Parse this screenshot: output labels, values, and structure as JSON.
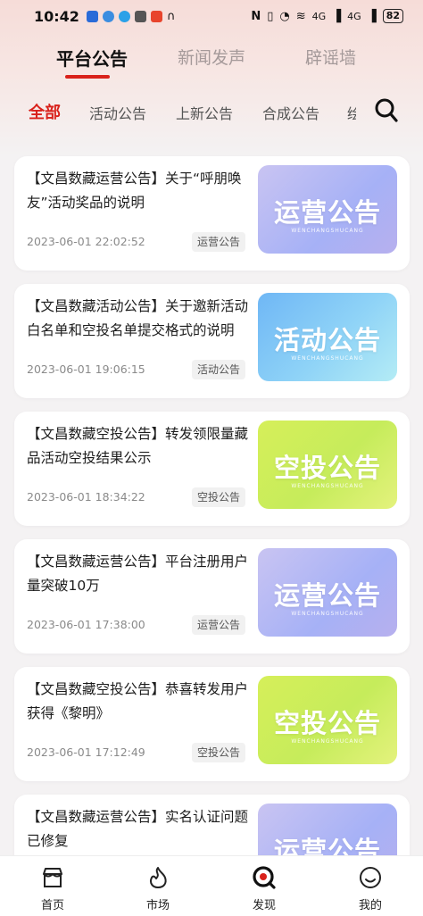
{
  "status_bar": {
    "time": "10:42",
    "signal_1": "4G",
    "signal_2": "4G",
    "battery": "82"
  },
  "main_tabs": [
    {
      "label": "平台公告",
      "active": true
    },
    {
      "label": "新闻发声",
      "active": false
    },
    {
      "label": "辟谣墙",
      "active": false
    }
  ],
  "category_tabs": [
    {
      "label": "全部",
      "active": true
    },
    {
      "label": "活动公告",
      "active": false
    },
    {
      "label": "上新公告",
      "active": false
    },
    {
      "label": "合成公告",
      "active": false
    },
    {
      "label": "绘",
      "active": false
    }
  ],
  "image_subtitle": "WENCHANGSHUCANG",
  "announcements": [
    {
      "title": "【文昌数藏运营公告】关于“呼朋唤友”活动奖品的说明",
      "date": "2023-06-01 22:02:52",
      "tag": "运营公告",
      "image_text": "运营公告",
      "image_style": "yunying"
    },
    {
      "title": "【文昌数藏活动公告】关于邀新活动白名单和空投名单提交格式的说明",
      "date": "2023-06-01 19:06:15",
      "tag": "活动公告",
      "image_text": "活动公告",
      "image_style": "huodong"
    },
    {
      "title": "【文昌数藏空投公告】转发领限量藏品活动空投结果公示",
      "date": "2023-06-01 18:34:22",
      "tag": "空投公告",
      "image_text": "空投公告",
      "image_style": "kongtou"
    },
    {
      "title": "【文昌数藏运营公告】平台注册用户量突破10万",
      "date": "2023-06-01 17:38:00",
      "tag": "运营公告",
      "image_text": "运营公告",
      "image_style": "yunying"
    },
    {
      "title": "【文昌数藏空投公告】恭喜转发用户获得《黎明》",
      "date": "2023-06-01 17:12:49",
      "tag": "空投公告",
      "image_text": "空投公告",
      "image_style": "kongtou"
    },
    {
      "title": "【文昌数藏运营公告】实名认证问题已修复",
      "date": "",
      "tag": "",
      "image_text": "运营公告",
      "image_style": "yunying"
    }
  ],
  "bottom_nav": [
    {
      "label": "首页",
      "icon": "shop-icon"
    },
    {
      "label": "市场",
      "icon": "market-flame-icon"
    },
    {
      "label": "发现",
      "icon": "discover-icon",
      "active": true
    },
    {
      "label": "我的",
      "icon": "profile-icon"
    }
  ],
  "colors": {
    "accent": "#d9211b"
  }
}
